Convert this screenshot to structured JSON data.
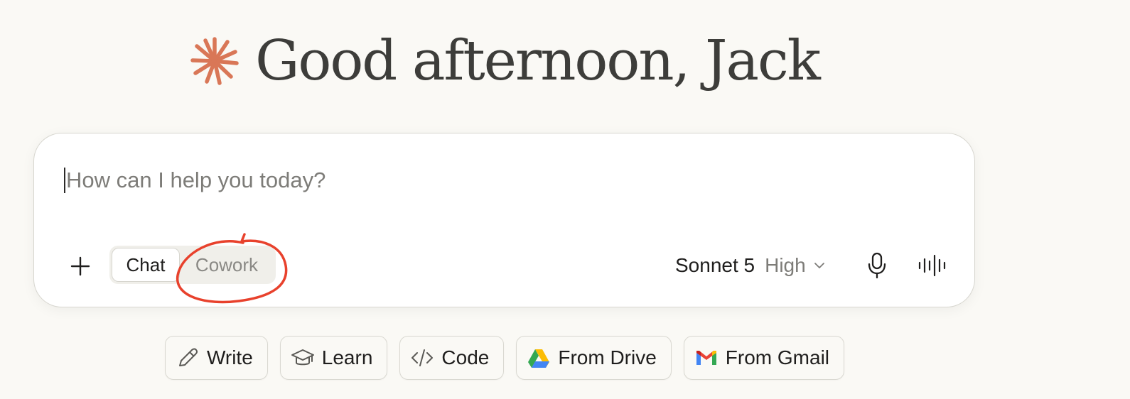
{
  "greeting": {
    "text": "Good afternoon, Jack",
    "accent_color": "#d97757"
  },
  "composer": {
    "placeholder": "How can I help you today?",
    "value": "",
    "plus_icon": "plus-icon",
    "modes": [
      {
        "label": "Chat",
        "active": true
      },
      {
        "label": "Cowork",
        "active": false
      }
    ],
    "model": {
      "name": "Sonnet 5",
      "effort": "High",
      "chevron_icon": "chevron-down-icon"
    },
    "mic_icon": "microphone-icon",
    "voice_icon": "voice-waveform-icon",
    "annotation_color": "#e8412c"
  },
  "chips": [
    {
      "label": "Write",
      "icon": "pencil-icon"
    },
    {
      "label": "Learn",
      "icon": "graduation-cap-icon"
    },
    {
      "label": "Code",
      "icon": "code-icon"
    },
    {
      "label": "From Drive",
      "icon": "google-drive-icon"
    },
    {
      "label": "From Gmail",
      "icon": "gmail-icon"
    }
  ]
}
